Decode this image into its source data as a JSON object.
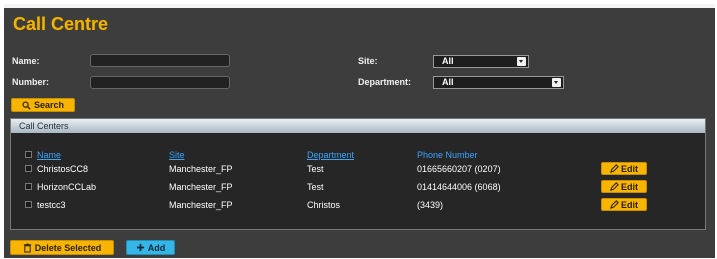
{
  "app": {
    "title": "Call Centre"
  },
  "filters": {
    "name_label": "Name:",
    "name_value": "",
    "number_label": "Number:",
    "number_value": "",
    "site_label": "Site:",
    "site_value": "All",
    "department_label": "Department:",
    "department_value": "All",
    "search_label": "Search"
  },
  "grid": {
    "title": "Call Centers",
    "columns": [
      "Name",
      "Site",
      "Department",
      "Phone Number"
    ],
    "rows": [
      {
        "name": "ChristosCC8",
        "site": "Manchester_FP",
        "department": "Test",
        "phone": "01665660207 (0207)",
        "edit": "Edit"
      },
      {
        "name": "HorizonCCLab",
        "site": "Manchester_FP",
        "department": "Test",
        "phone": "01414644006 (6068)",
        "edit": "Edit"
      },
      {
        "name": "testcc3",
        "site": "Manchester_FP",
        "department": "Christos",
        "phone": "(3439)",
        "edit": "Edit"
      }
    ]
  },
  "actions": {
    "delete_label": "Delete Selected",
    "add_label": "Add"
  },
  "colors": {
    "accent": "#f7b500",
    "panel": "#3d3d3d",
    "link": "#3aa4ff",
    "add": "#35b6e6"
  },
  "icons": {
    "search": "search-icon",
    "edit": "pencil-icon",
    "delete": "trash-icon",
    "add": "plus-icon"
  }
}
